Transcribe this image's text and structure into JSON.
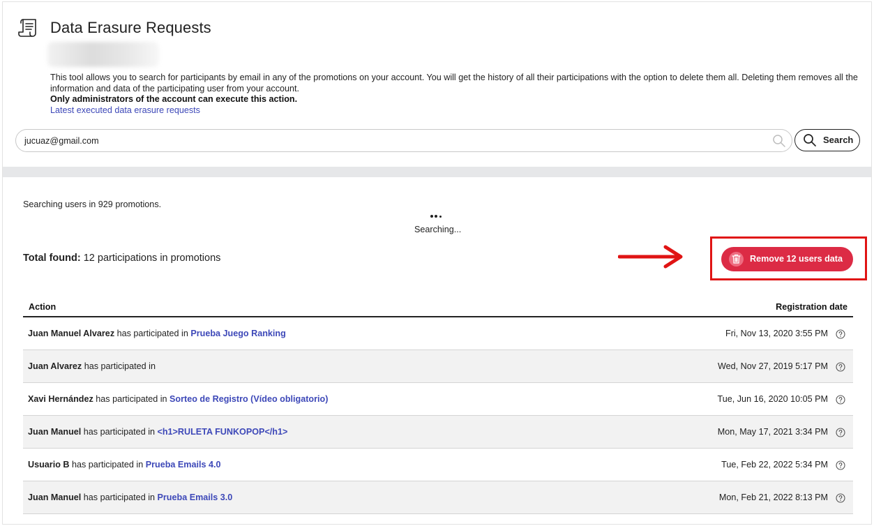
{
  "header": {
    "title": "Data Erasure Requests",
    "icon": "scroll-icon"
  },
  "intro": {
    "description": "This tool allows you to search for participants by email in any of the promotions on your account. You will get the history of all their participations with the option to delete them all. Deleting them removes all the information and data of the participating user from your account.",
    "admin_note": "Only administrators of the account can execute this action.",
    "history_link": "Latest executed data erasure requests"
  },
  "search": {
    "value": "jucuaz@gmail.com",
    "button_label": "Search"
  },
  "status": {
    "searching_count": "Searching users in 929 promotions.",
    "searching_label": "Searching..."
  },
  "summary": {
    "total_label": "Total found:",
    "total_value": "12 participations in promotions",
    "remove_button": "Remove 12 users data"
  },
  "colors": {
    "accent_red": "#dc2b45",
    "highlight_red": "#e01414",
    "link_blue": "#3d48b8"
  },
  "table": {
    "columns": [
      "Action",
      "Registration date"
    ],
    "participated_text": "has participated in",
    "rows": [
      {
        "name": "Juan Manuel Alvarez",
        "promotion": "Prueba Juego Ranking",
        "date": "Fri, Nov 13, 2020 3:55 PM"
      },
      {
        "name": "Juan Alvarez",
        "promotion": "",
        "date": "Wed, Nov 27, 2019 5:17 PM"
      },
      {
        "name": "Xavi Hernández",
        "promotion": "Sorteo de Registro (Vídeo obligatorio)",
        "date": "Tue, Jun 16, 2020 10:05 PM"
      },
      {
        "name": "Juan Manuel",
        "promotion": "<h1>RULETA FUNKOPOP</h1>",
        "date": "Mon, May 17, 2021 3:34 PM"
      },
      {
        "name": "Usuario B",
        "promotion": "Prueba Emails 4.0",
        "date": "Tue, Feb 22, 2022 5:34 PM"
      },
      {
        "name": "Juan Manuel",
        "promotion": "Prueba Emails 3.0",
        "date": "Mon, Feb 21, 2022 8:13 PM"
      }
    ]
  }
}
